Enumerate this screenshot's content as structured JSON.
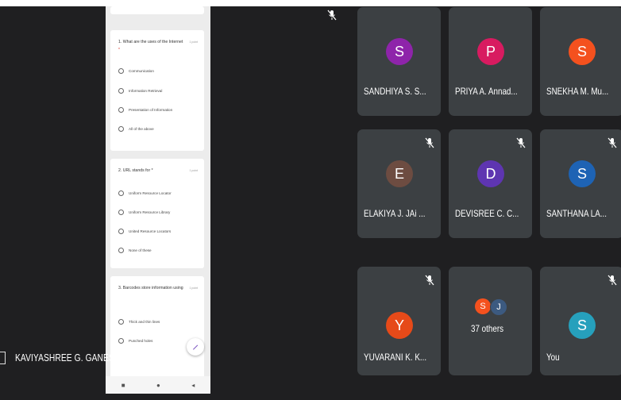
{
  "presenter": {
    "name": "KAVIYASHREE G. GANESANAN"
  },
  "form": {
    "questions": [
      {
        "text": "1. What are the uses of the Internet",
        "points": "1 point",
        "options": [
          "Communication",
          "Information Retrieval",
          "Presentation of Information",
          "All of the above"
        ]
      },
      {
        "text": "2. URL stands for *",
        "points": "1 point",
        "options": [
          "Uniform Resource Locator",
          "Uniform Resource Library",
          "United Resource Locators",
          "None of these"
        ]
      },
      {
        "text": "3. Barcodes store information using",
        "points": "1 point",
        "options": [
          "Thick and thin lines",
          "Punched holes"
        ]
      }
    ],
    "nav": {
      "square": "■",
      "circle": "●",
      "back": "◂"
    }
  },
  "participants": [
    {
      "name": "SANDHIYA S. S...",
      "initial": "S",
      "color": "#8e24aa"
    },
    {
      "name": "PRIYA A. Annad...",
      "initial": "P",
      "color": "#d81b60"
    },
    {
      "name": "SNEKHA M. Mu...",
      "initial": "S",
      "color": "#f4511e"
    },
    {
      "name": "ELAKIYA J. JAi ...",
      "initial": "E",
      "color": "#6d4c41"
    },
    {
      "name": "DEVISREE C. C...",
      "initial": "D",
      "color": "#5e35b1"
    },
    {
      "name": "SANTHANA LA...",
      "initial": "S",
      "color": "#1e63b4"
    },
    {
      "name": "YUVARANI K. K...",
      "initial": "Y",
      "color": "#e64a19"
    },
    {
      "name": "37 others",
      "mini": [
        {
          "initial": "S",
          "color": "#f4511e"
        },
        {
          "initial": "J",
          "color": "#3c5a80"
        }
      ]
    },
    {
      "name": "You",
      "initial": "S",
      "color": "#26a0bc"
    }
  ],
  "icons": {
    "mic_off": "mic-off-icon",
    "edit": "pencil-icon"
  }
}
